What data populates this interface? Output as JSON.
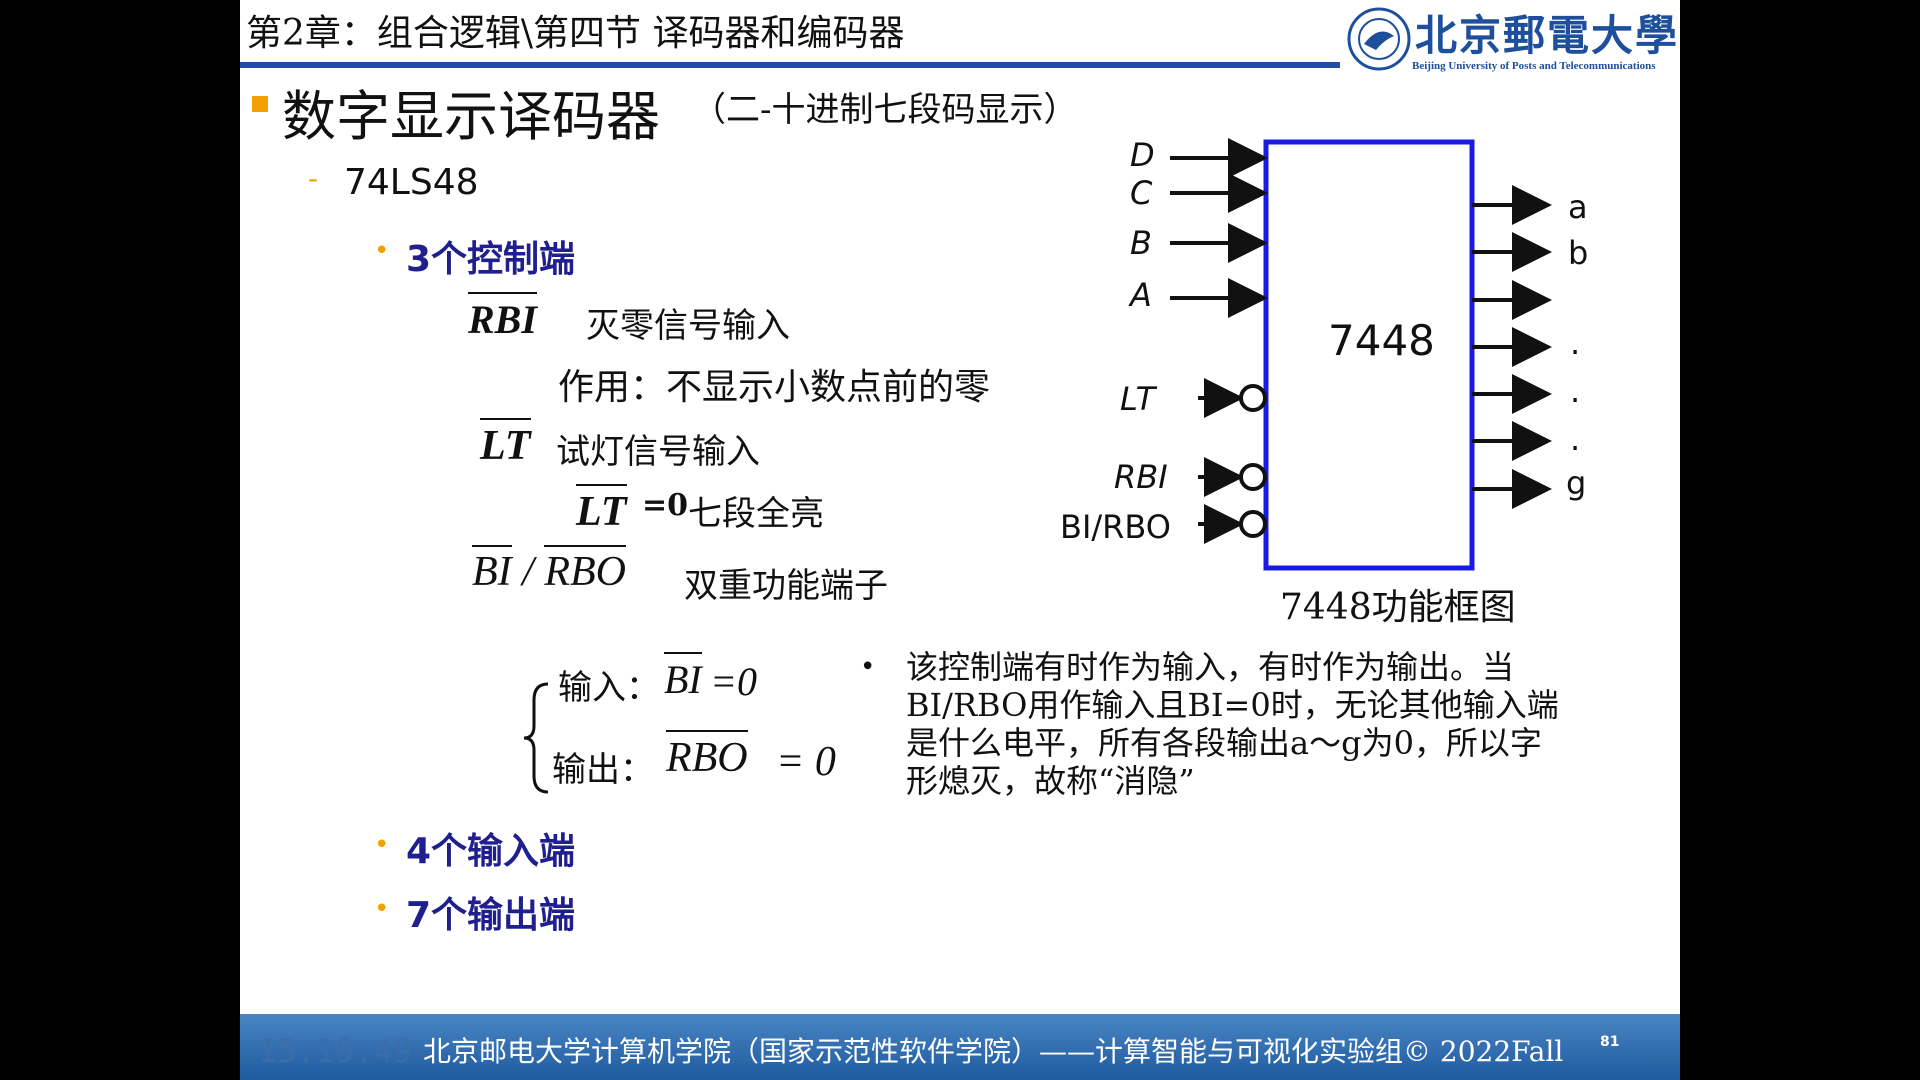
{
  "header": {
    "title": "第2章：组合逻辑\\第四节  译码器和编码器",
    "logo_text": "北京郵電大學",
    "logo_sub": "Beijing University of Posts and Telecommunications"
  },
  "main": {
    "title": "数字显示译码器",
    "subtitle": "（二-十进制七段码显示）",
    "sub_item": "74LS48",
    "control": {
      "heading": "3个控制端",
      "rbi_sym": "RBI",
      "rbi_label": "灭零信号输入",
      "rbi_desc": "作用：不显示小数点前的零",
      "lt_sym": "LT",
      "lt_label": "试灯信号输入",
      "lt2_sym": "LT",
      "lt2_eq": "=0",
      "lt2_desc": "七段全亮",
      "bi_sym": "BI",
      "slash": "/",
      "rbo_sym": "RBO",
      "bi_desc": "双重功能端子",
      "brace_in_label": "输入：",
      "brace_in_sym": "BI",
      "brace_in_eq": "=0",
      "brace_out_label": "输出：",
      "brace_out_sym": "RBO",
      "brace_out_eq": "= 0",
      "note_bullet": "•",
      "note_lines": [
        "该控制端有时作为输入，有时作为输出。当",
        "BI/RBO用作输入且BI=0时，无论其他输入端",
        "是什么电平，所有各段输出a～g为0，所以字",
        "形熄灭，故称“消隐”"
      ]
    },
    "inputs_heading": "4个输入端",
    "outputs_heading": "7个输出端"
  },
  "diagram": {
    "chip_label": "7448",
    "caption": "7448功能框图",
    "inputs": [
      "D",
      "C",
      "B",
      "A"
    ],
    "controls": [
      "LT",
      "RBI",
      "BI/RBO"
    ],
    "outputs": [
      "a",
      "b",
      "",
      ".",
      ".",
      ".",
      "g"
    ]
  },
  "footer": {
    "time": "15:19:49",
    "text": "北京邮电大学计算机学院（国家示范性软件学院）——计算智能与可视化实验组© 2022Fall",
    "page": "81"
  },
  "colors": {
    "accent": "#1f4ea3",
    "bullet": "#f4a000",
    "heading_blue": "#1f1f8f",
    "chip_border": "#1a1ae6"
  }
}
